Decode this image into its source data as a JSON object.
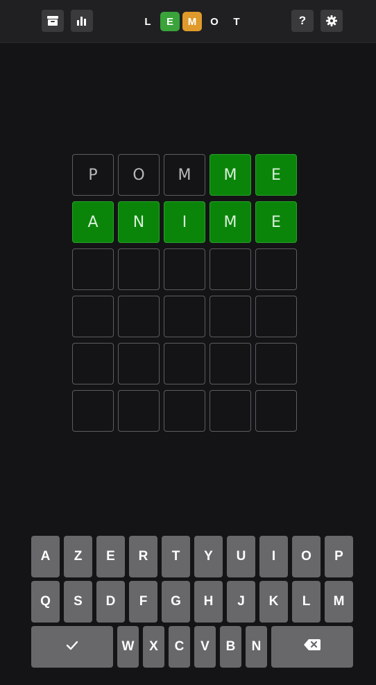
{
  "header": {
    "archive_icon": "archive-icon",
    "stats_icon": "bar-chart-icon",
    "help_label": "?",
    "settings_icon": "gear-icon",
    "logo": [
      {
        "letter": "L",
        "state": "none"
      },
      {
        "letter": "E",
        "state": "correct"
      },
      {
        "letter": "M",
        "state": "present"
      },
      {
        "letter": "O",
        "state": "none"
      },
      {
        "letter": "T",
        "state": "none"
      }
    ]
  },
  "colors": {
    "correct": "#0a850a",
    "present": "#e09a2b",
    "key": "#68686b",
    "background": "#141416"
  },
  "board": {
    "rows": [
      [
        {
          "letter": "P",
          "state": "absent"
        },
        {
          "letter": "O",
          "state": "absent"
        },
        {
          "letter": "M",
          "state": "absent"
        },
        {
          "letter": "M",
          "state": "correct"
        },
        {
          "letter": "E",
          "state": "correct"
        }
      ],
      [
        {
          "letter": "A",
          "state": "correct"
        },
        {
          "letter": "N",
          "state": "correct"
        },
        {
          "letter": "I",
          "state": "correct"
        },
        {
          "letter": "M",
          "state": "correct"
        },
        {
          "letter": "E",
          "state": "correct"
        }
      ],
      [
        {
          "letter": "",
          "state": "empty"
        },
        {
          "letter": "",
          "state": "empty"
        },
        {
          "letter": "",
          "state": "empty"
        },
        {
          "letter": "",
          "state": "empty"
        },
        {
          "letter": "",
          "state": "empty"
        }
      ],
      [
        {
          "letter": "",
          "state": "empty"
        },
        {
          "letter": "",
          "state": "empty"
        },
        {
          "letter": "",
          "state": "empty"
        },
        {
          "letter": "",
          "state": "empty"
        },
        {
          "letter": "",
          "state": "empty"
        }
      ],
      [
        {
          "letter": "",
          "state": "empty"
        },
        {
          "letter": "",
          "state": "empty"
        },
        {
          "letter": "",
          "state": "empty"
        },
        {
          "letter": "",
          "state": "empty"
        },
        {
          "letter": "",
          "state": "empty"
        }
      ],
      [
        {
          "letter": "",
          "state": "empty"
        },
        {
          "letter": "",
          "state": "empty"
        },
        {
          "letter": "",
          "state": "empty"
        },
        {
          "letter": "",
          "state": "empty"
        },
        {
          "letter": "",
          "state": "empty"
        }
      ]
    ]
  },
  "keyboard": {
    "row1": [
      "A",
      "Z",
      "E",
      "R",
      "T",
      "Y",
      "U",
      "I",
      "O",
      "P"
    ],
    "row2": [
      "Q",
      "S",
      "D",
      "F",
      "G",
      "H",
      "J",
      "K",
      "L",
      "M"
    ],
    "row3": [
      "W",
      "X",
      "C",
      "V",
      "B",
      "N"
    ],
    "enter_icon": "check-icon",
    "backspace_icon": "backspace-icon"
  }
}
